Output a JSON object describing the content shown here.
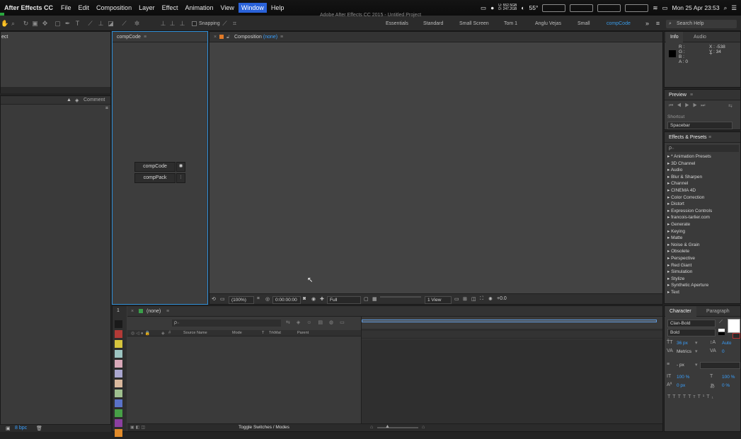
{
  "menubar": {
    "app_name": "After Effects CC",
    "items": [
      "File",
      "Edit",
      "Composition",
      "Layer",
      "Effect",
      "Animation",
      "View",
      "Window",
      "Help"
    ],
    "active_item": "Window",
    "status": {
      "net_up": "U: 552.5GB",
      "net_down": "D: 247.2GB",
      "temperature": "55°",
      "datetime": "Mon 25 Apr 23:53"
    }
  },
  "window_title": "Adobe After Effects CC 2015 - Untitled Project",
  "toolbar": {
    "snapping_label": "Snapping",
    "workspaces": [
      "Essentials",
      "Standard",
      "Small Screen",
      "Tom 1",
      "Anglu Vejas",
      "Small",
      "compCode"
    ],
    "active_workspace": "compCode",
    "search_placeholder": "Search Help"
  },
  "project_panel": {
    "title_fragment": "ect",
    "comment_header": "Comment",
    "bpc": "8 bpc"
  },
  "compcode_panel": {
    "tab_label": "compCode",
    "buttons": [
      "compCode",
      "compPack"
    ]
  },
  "composition_panel": {
    "tab_label": "Composition",
    "tab_sub": "(none)",
    "footer": {
      "zoom": "(100%)",
      "timecode": "0:00:00:00",
      "resolution": "Full",
      "views": "1 View",
      "exposure": "+0.0"
    }
  },
  "info_panel": {
    "tabs": [
      "Info",
      "Audio"
    ],
    "rgba_labels": [
      "R :",
      "G :",
      "B :",
      "A : 0"
    ],
    "coords": [
      "X : -538",
      "Y : 34"
    ]
  },
  "preview_panel": {
    "title": "Preview",
    "shortcut_label": "Shortcut",
    "shortcut_value": "Spacebar"
  },
  "effects_panel": {
    "title": "Effects & Presets",
    "search_placeholder": "ρ₋",
    "categories": [
      "* Animation Presets",
      "3D Channel",
      "Audio",
      "Blur & Sharpen",
      "Channel",
      "CINEMA 4D",
      "Color Correction",
      "Distort",
      "Expression Controls",
      "francois-tarlier.com",
      "Generate",
      "Keying",
      "Matte",
      "Noise & Grain",
      "Obsolete",
      "Perspective",
      "Red Giant",
      "Simulation",
      "Stylize",
      "Synthetic Aperture",
      "Text"
    ]
  },
  "timeline_panel": {
    "tab_label": "(none)",
    "search_placeholder": "ρ₋",
    "columns": [
      "Source Name",
      "Mode",
      "T",
      "TrkMat",
      "Parent"
    ],
    "toggle_label": "Toggle Switches / Modes",
    "swatches": [
      "#1a1a1a",
      "#b23a37",
      "#d6c43d",
      "#9cc4c0",
      "#d8a8b8",
      "#a9a6cf",
      "#d9b89d",
      "#9fc08f",
      "#5a72c8",
      "#47a047",
      "#8b3fa0",
      "#e08a2a"
    ]
  },
  "character_panel": {
    "tabs": [
      "Character",
      "Paragraph"
    ],
    "font_family": "Clan-Bold",
    "font_style": "Bold",
    "font_size": "36 px",
    "leading": "Auto",
    "kerning": "Metrics",
    "tracking": "0",
    "stroke_width": "- px",
    "vert_scale": "100 %",
    "horiz_scale": "100 %",
    "baseline_shift": "0 px",
    "tsume": "0 %"
  },
  "colors": {
    "accent_blue": "#2a62d9",
    "panel_highlight": "#2f8fd8",
    "value_blue": "#39a0ff"
  }
}
